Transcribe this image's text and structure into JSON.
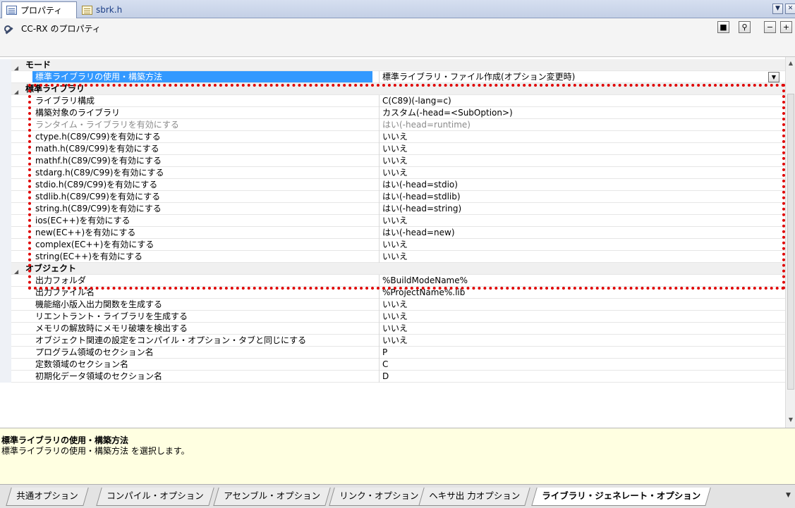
{
  "tabs": [
    {
      "label": "プロパティ",
      "icon": "properties-icon"
    },
    {
      "label": "sbrk.h",
      "icon": "file-icon"
    }
  ],
  "header": {
    "title": "CC-RX のプロパティ"
  },
  "grid": {
    "rows": [
      {
        "type": "category",
        "name": "モード"
      },
      {
        "type": "prop",
        "name": "標準ライブラリの使用・構築方法",
        "value": "標準ライブラリ・ファイル作成(オプション変更時)",
        "selected": true
      },
      {
        "type": "category",
        "name": "標準ライブラリ"
      },
      {
        "type": "prop",
        "name": "ライブラリ構成",
        "value": "C(C89)(-lang=c)"
      },
      {
        "type": "prop",
        "name": "構築対象のライブラリ",
        "value": "カスタム(-head=<SubOption>)"
      },
      {
        "type": "prop",
        "name": "ランタイム・ライブラリを有効にする",
        "value": "はい(-head=runtime)",
        "disabled": true
      },
      {
        "type": "prop",
        "name": "ctype.h(C89/C99)を有効にする",
        "value": "いいえ"
      },
      {
        "type": "prop",
        "name": "math.h(C89/C99)を有効にする",
        "value": "いいえ"
      },
      {
        "type": "prop",
        "name": "mathf.h(C89/C99)を有効にする",
        "value": "いいえ"
      },
      {
        "type": "prop",
        "name": "stdarg.h(C89/C99)を有効にする",
        "value": "いいえ"
      },
      {
        "type": "prop",
        "name": "stdio.h(C89/C99)を有効にする",
        "value": "はい(-head=stdio)"
      },
      {
        "type": "prop",
        "name": "stdlib.h(C89/C99)を有効にする",
        "value": "はい(-head=stdlib)"
      },
      {
        "type": "prop",
        "name": "string.h(C89/C99)を有効にする",
        "value": "はい(-head=string)"
      },
      {
        "type": "prop",
        "name": "ios(EC++)を有効にする",
        "value": "いいえ"
      },
      {
        "type": "prop",
        "name": "new(EC++)を有効にする",
        "value": "はい(-head=new)"
      },
      {
        "type": "prop",
        "name": "complex(EC++)を有効にする",
        "value": "いいえ"
      },
      {
        "type": "prop",
        "name": "string(EC++)を有効にする",
        "value": "いいえ"
      },
      {
        "type": "category",
        "name": "オブジェクト"
      },
      {
        "type": "prop",
        "name": "出力フォルダ",
        "value": "%BuildModeName%"
      },
      {
        "type": "prop",
        "name": "出力ファイル名",
        "value": "%ProjectName%.lib"
      },
      {
        "type": "prop",
        "name": "機能縮小版入出力関数を生成する",
        "value": "いいえ"
      },
      {
        "type": "prop",
        "name": "リエントラント・ライブラリを生成する",
        "value": "いいえ"
      },
      {
        "type": "prop",
        "name": "メモリの解放時にメモリ破壊を検出する",
        "value": "いいえ"
      },
      {
        "type": "prop",
        "name": "オブジェクト関連の設定をコンパイル・オプション・タブと同じにする",
        "value": "いいえ"
      },
      {
        "type": "prop",
        "name": "プログラム領域のセクション名",
        "value": "P"
      },
      {
        "type": "prop",
        "name": "定数領域のセクション名",
        "value": "C"
      },
      {
        "type": "prop",
        "name": "初期化データ領域のセクション名",
        "value": "D"
      }
    ]
  },
  "description": {
    "title": "標準ライブラリの使用・構築方法",
    "text": "標準ライブラリの使用・構築方法 を選択します。"
  },
  "bottom_tabs": [
    "共通オプション",
    "コンパイル・オプション",
    "アセンブル・オプション",
    "リンク・オプション",
    "ヘキサ出 力オプション",
    "ライブラリ・ジェネレート・オプション"
  ],
  "active_bottom_tab": 5,
  "colors": {
    "selection": "#3399ff",
    "highlight_box": "#e00000",
    "description_bg": "#ffffe1"
  }
}
